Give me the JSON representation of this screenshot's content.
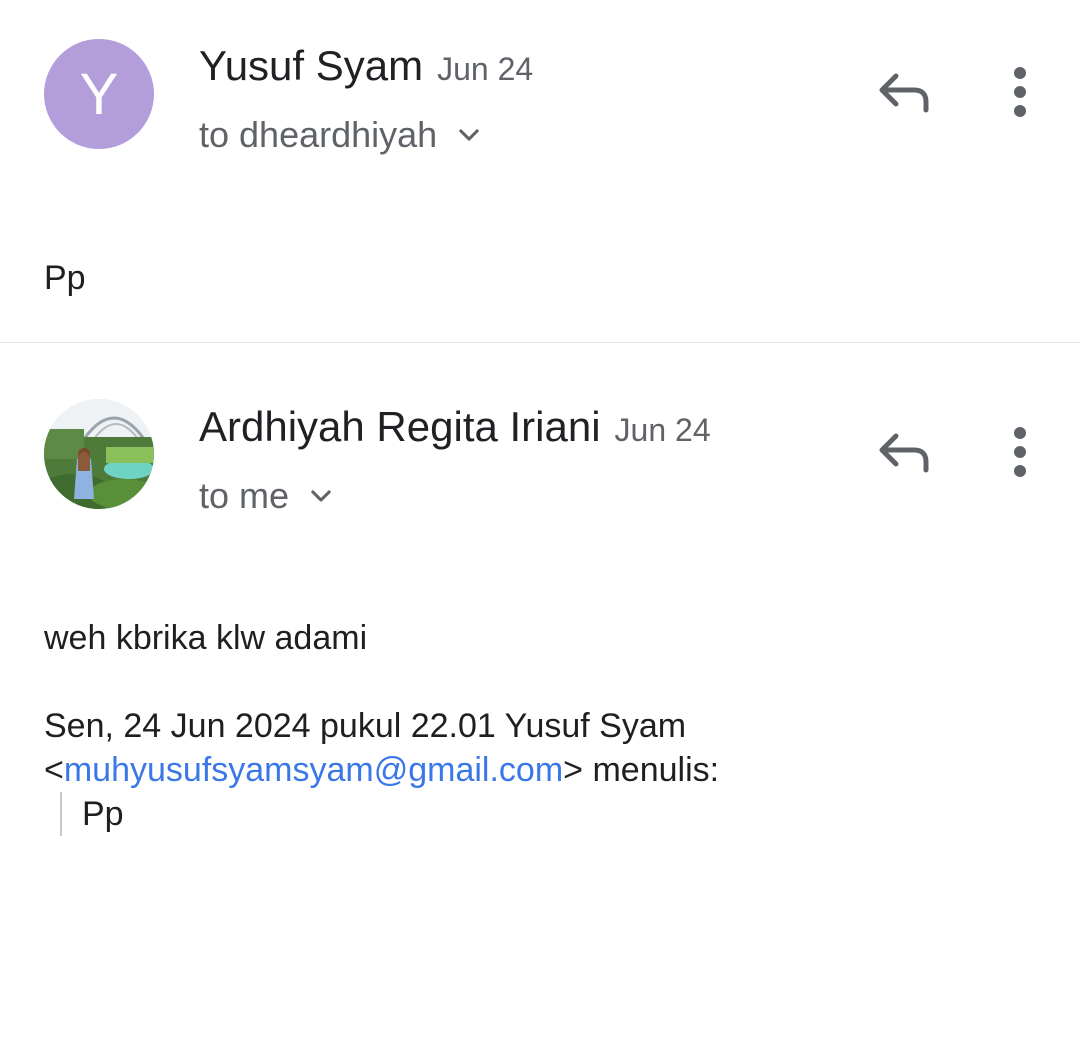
{
  "thread": [
    {
      "avatar_letter": "Y",
      "avatar_color": "#b39ddb",
      "sender": "Yusuf Syam",
      "date": "Jun 24",
      "recipient": "to dheardhiyah",
      "body": "Pp"
    },
    {
      "avatar_image": "profile-photo",
      "sender": "Ardhiyah Regita Iriani",
      "date": "Jun 24",
      "recipient": "to me",
      "body": "weh kbrika klw adami",
      "quote_header_line1": "Sen, 24 Jun 2024 pukul 22.01 Yusuf Syam",
      "quote_open": "<",
      "quote_email": "muhyusufsyamsyam@gmail.com",
      "quote_close": "> menulis:",
      "quoted_text": "Pp"
    }
  ],
  "icons": {
    "reply": "reply-icon",
    "more": "more-vert-icon",
    "expand": "chevron-down-icon"
  },
  "colors": {
    "link": "#3b78e7",
    "secondary_text": "#5f6368"
  }
}
